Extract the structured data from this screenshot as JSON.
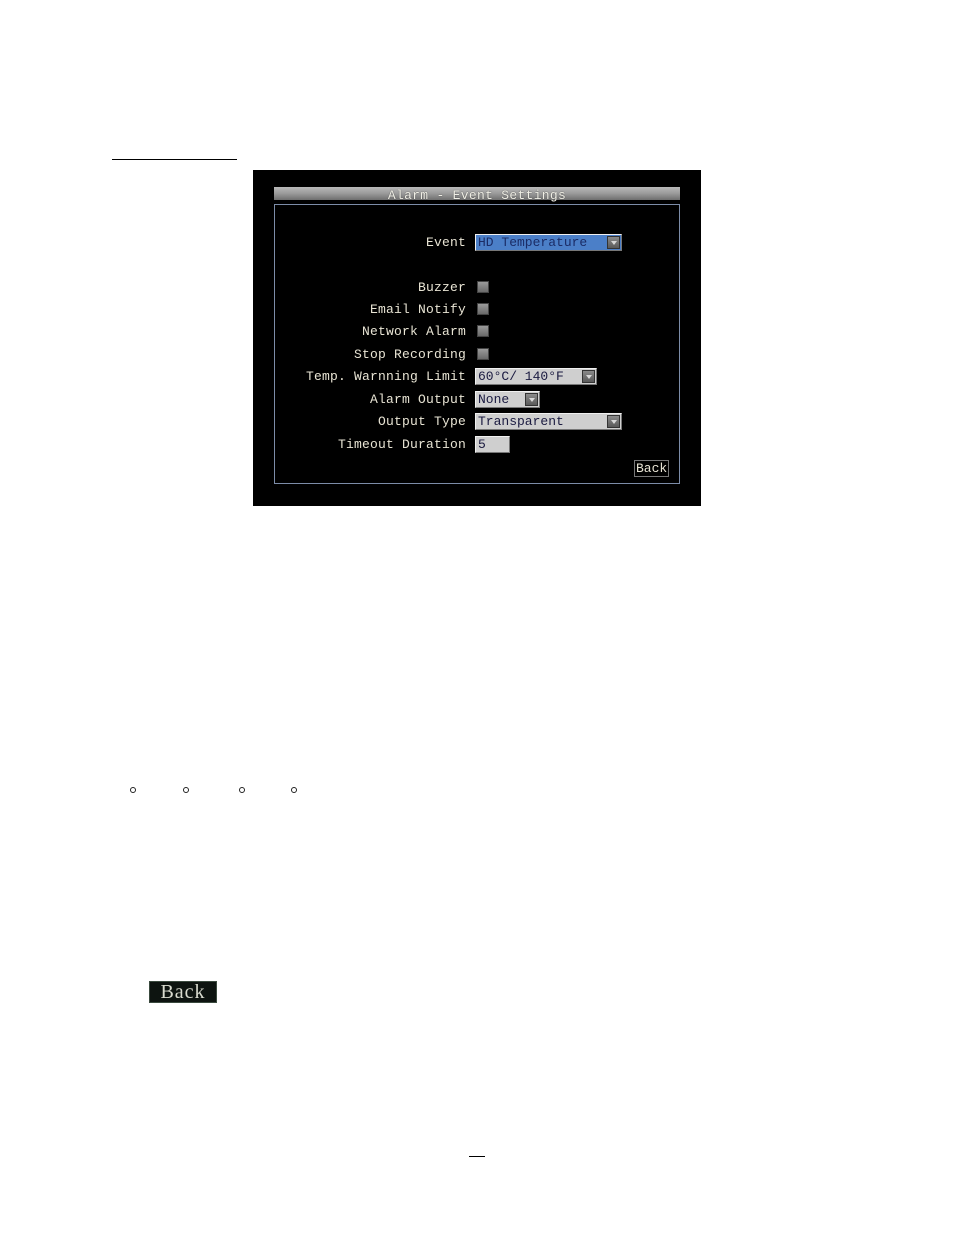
{
  "dialog": {
    "title": "Alarm - Event Settings",
    "event": {
      "label": "Event",
      "value": "HD Temperature"
    },
    "checkboxes": [
      {
        "label": "Buzzer",
        "checked": false
      },
      {
        "label": "Email Notify",
        "checked": false
      },
      {
        "label": "Network Alarm",
        "checked": false
      },
      {
        "label": "Stop Recording",
        "checked": false
      }
    ],
    "temp_limit": {
      "label": "Temp. Warnning Limit",
      "value": "60°C/ 140°F"
    },
    "alarm_output": {
      "label": "Alarm Output",
      "value": "None"
    },
    "output_type": {
      "label": "Output Type",
      "value": "Transparent"
    },
    "timeout": {
      "label": "Timeout Duration",
      "value": "5"
    },
    "back_label": "Back"
  },
  "back_icon_label": "Back",
  "bullets_count": 4
}
